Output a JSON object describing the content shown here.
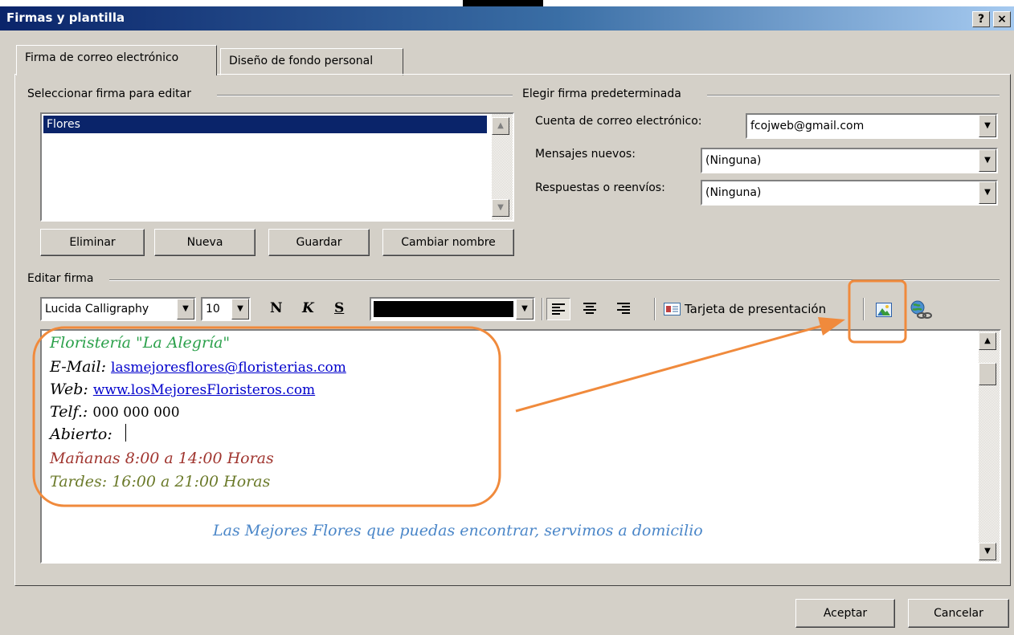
{
  "window": {
    "title": "Firmas y plantilla",
    "help_label": "?",
    "close_label": "×"
  },
  "tabs": [
    {
      "label": "Firma de correo electrónico"
    },
    {
      "label": "Diseño de fondo personal"
    }
  ],
  "select_group": {
    "label": "Seleccionar firma para editar",
    "items": [
      "Flores"
    ],
    "selected": "Flores",
    "buttons": {
      "delete": "Eliminar",
      "new": "Nueva",
      "save": "Guardar",
      "rename": "Cambiar nombre"
    }
  },
  "default_group": {
    "label": "Elegir firma predeterminada",
    "account_label": "Cuenta de correo electrónico:",
    "account_value": "fcojweb@gmail.com",
    "new_messages_label": "Mensajes nuevos:",
    "new_messages_value": "(Ninguna)",
    "replies_label": "Respuestas o reenvíos:",
    "replies_value": "(Ninguna)"
  },
  "edit_group": {
    "label": "Editar firma",
    "font_name": "Lucida Calligraphy",
    "font_size": "10",
    "bold": "N",
    "italic": "K",
    "underline": "S",
    "business_card_label": "Tarjeta de presentación",
    "font_color": "#000000"
  },
  "signature": {
    "line1": "Floristería \"La Alegría\"",
    "email_label": "E-Mail:",
    "email_link": "lasmejoresflores@floristerias.com",
    "web_label": "Web:",
    "web_link": "www.losMejoresFloristeros.com",
    "tel_label": "Telf.:",
    "tel_value": "000 000 000",
    "open_label": "Abierto:",
    "mornings": "Mañanas 8:00 a 14:00 Horas",
    "afternoons": "Tardes: 16:00 a 21:00 Horas",
    "footer": "Las Mejores Flores que puedas encontrar, servimos a domicilio",
    "colors": {
      "title": "#2aa04a",
      "mornings": "#a0352f",
      "afternoons": "#6b7a2a",
      "footer": "#4a86c8"
    }
  },
  "footer_buttons": {
    "ok": "Aceptar",
    "cancel": "Cancelar"
  },
  "annotation": {
    "color": "#f08a3c"
  }
}
